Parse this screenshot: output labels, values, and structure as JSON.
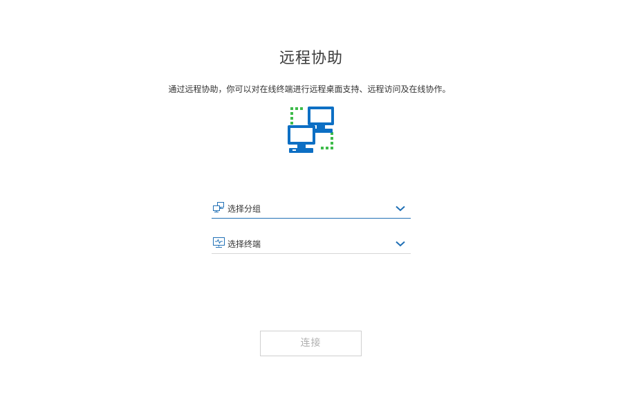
{
  "page": {
    "title": "远程协助",
    "description": "通过远程协助，你可以对在线终端进行远程桌面支持、远程访问及在线协作。",
    "hero_icon": "remote-computers-icon"
  },
  "form": {
    "group_select": {
      "placeholder": "选择分组",
      "icon": "group-computers-icon"
    },
    "terminal_select": {
      "placeholder": "选择终端",
      "icon": "monitor-icon"
    }
  },
  "actions": {
    "connect_label": "连接"
  },
  "colors": {
    "accent": "#1f6fb5",
    "hero_blue": "#0d6fc4",
    "hero_green": "#3dbb4a",
    "button_disabled_text": "#b0b0b0"
  }
}
